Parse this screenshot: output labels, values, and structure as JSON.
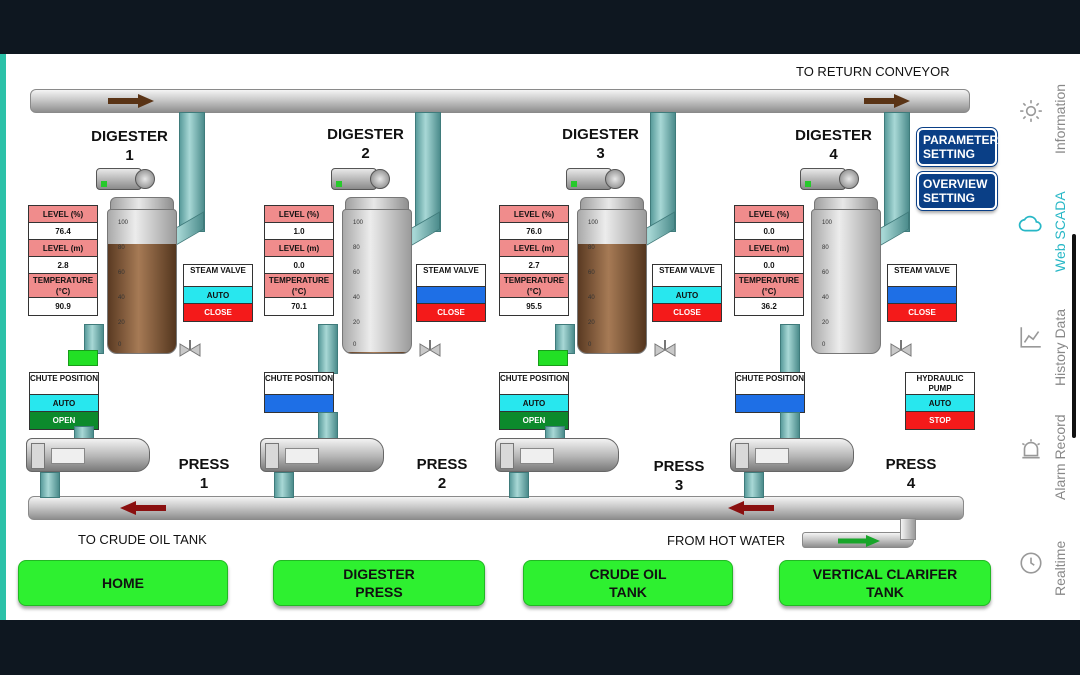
{
  "labels": {
    "to_return_conveyor": "TO RETURN CONVEYOR",
    "to_crude_oil_tank": "TO CRUDE OIL TANK",
    "from_hot_water": "FROM HOT WATER"
  },
  "digesters": [
    {
      "title": "DIGESTER",
      "num": "1",
      "level_pct_label": "LEVEL (%)",
      "level_pct": "76.4",
      "level_m_label": "LEVEL (m)",
      "level_m": "2.8",
      "temp_label": "TEMPERATURE (°C)",
      "temp": "90.9",
      "fill": 0.76,
      "steam_label": "STEAM VALVE",
      "steam_mode": "AUTO",
      "steam_state": "CLOSE",
      "chute_label": "CHUTE POSITION",
      "chute_mode": "AUTO",
      "chute_state": "OPEN"
    },
    {
      "title": "DIGESTER",
      "num": "2",
      "level_pct_label": "LEVEL (%)",
      "level_pct": "1.0",
      "level_m_label": "LEVEL (m)",
      "level_m": "0.0",
      "temp_label": "TEMPERATURE (°C)",
      "temp": "70.1",
      "fill": 0.01,
      "steam_label": "STEAM VALVE",
      "steam_mode": "",
      "steam_state": "CLOSE",
      "chute_label": "CHUTE POSITION",
      "chute_mode": "",
      "chute_state": ""
    },
    {
      "title": "DIGESTER",
      "num": "3",
      "level_pct_label": "LEVEL (%)",
      "level_pct": "76.0",
      "level_m_label": "LEVEL (m)",
      "level_m": "2.7",
      "temp_label": "TEMPERATURE (°C)",
      "temp": "95.5",
      "fill": 0.76,
      "steam_label": "STEAM VALVE",
      "steam_mode": "AUTO",
      "steam_state": "CLOSE",
      "chute_label": "CHUTE POSITION",
      "chute_mode": "AUTO",
      "chute_state": "OPEN"
    },
    {
      "title": "DIGESTER",
      "num": "4",
      "level_pct_label": "LEVEL (%)",
      "level_pct": "0.0",
      "level_m_label": "LEVEL (m)",
      "level_m": "0.0",
      "temp_label": "TEMPERATURE (°C)",
      "temp": "36.2",
      "fill": 0.0,
      "steam_label": "STEAM VALVE",
      "steam_mode": "",
      "steam_state": "CLOSE",
      "chute_label": "CHUTE POSITION",
      "chute_mode": "",
      "chute_state": ""
    }
  ],
  "scale": [
    "100",
    "80",
    "60",
    "40",
    "20",
    "0"
  ],
  "presses": [
    {
      "title": "PRESS",
      "num": "1"
    },
    {
      "title": "PRESS",
      "num": "2"
    },
    {
      "title": "PRESS",
      "num": "3"
    },
    {
      "title": "PRESS",
      "num": "4"
    }
  ],
  "hydraulic_pump": {
    "label": "HYDRAULIC PUMP",
    "mode": "AUTO",
    "state": "STOP"
  },
  "nav_buttons": {
    "parameter_setting": "PARAMETER SETTING",
    "overview_setting": "OVERVIEW SETTING"
  },
  "bottom_buttons": {
    "home": "HOME",
    "digester_press": "DIGESTER PRESS",
    "crude_oil_tank": "CRUDE OIL TANK",
    "vertical_clarifier": "VERTICAL CLARIFER TANK"
  },
  "side_nav": {
    "information": "Information",
    "web_scada": "Web SCADA",
    "history_data": "History Data",
    "alarm_record": "Alarm Record",
    "realtime": "Realtime"
  },
  "colors": {
    "pink": "#f08c8c",
    "cyan": "#28e7ee",
    "red": "#f41a1a",
    "blue": "#1e6fe6",
    "green": "#0c8a2c",
    "bright_green": "#2ef030",
    "active_nav": "#27b7c6"
  }
}
